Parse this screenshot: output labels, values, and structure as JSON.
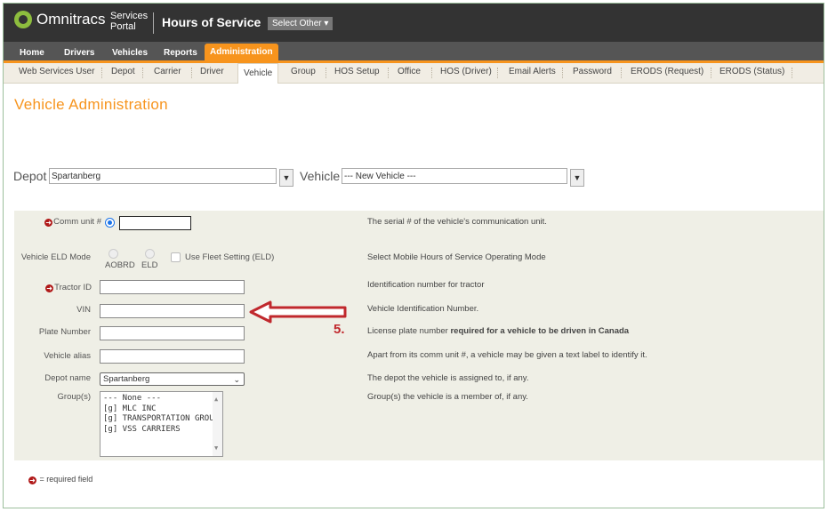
{
  "header": {
    "logo_text": "Omnitracs",
    "services_line1": "Services",
    "services_line2": "Portal",
    "app_title": "Hours of Service",
    "select_other": "Select Other ▾"
  },
  "nav": {
    "items": [
      "Home",
      "Drivers",
      "Vehicles",
      "Reports",
      "Administration"
    ],
    "active": "Administration"
  },
  "subnav": {
    "items": [
      "Web Services User",
      "Depot",
      "Carrier",
      "Driver",
      "Vehicle",
      "Group",
      "HOS Setup",
      "Office",
      "HOS (Driver)",
      "Email Alerts",
      "Password",
      "ERODS (Request)",
      "ERODS (Status)"
    ],
    "active": "Vehicle"
  },
  "page": {
    "title": "Vehicle Administration"
  },
  "selectors": {
    "depot_label": "Depot",
    "depot_value": "Spartanberg",
    "vehicle_label": "Vehicle",
    "vehicle_value": "--- New Vehicle ---"
  },
  "form": {
    "comm_unit": {
      "label": "Comm unit #",
      "value": "",
      "desc": "The serial # of the vehicle's communication unit."
    },
    "eld_mode": {
      "label": "Vehicle ELD Mode",
      "opt1": "AOBRD",
      "opt2": "ELD",
      "fleet_setting": "Use Fleet Setting (ELD)",
      "desc": "Select Mobile Hours of Service Operating Mode"
    },
    "tractor_id": {
      "label": "Tractor ID",
      "value": "",
      "desc": "Identification number for tractor"
    },
    "vin": {
      "label": "VIN",
      "value": "",
      "desc": "Vehicle Identification Number."
    },
    "plate": {
      "label": "Plate Number",
      "value": "",
      "desc_normal": "License plate number ",
      "desc_bold": "required for a vehicle to be driven in Canada"
    },
    "alias": {
      "label": "Vehicle alias",
      "value": "",
      "desc": "Apart from its comm unit #, a vehicle may be given a text label to identify it."
    },
    "depot_name": {
      "label": "Depot name",
      "value": "Spartanberg",
      "desc": "The depot the vehicle is assigned to, if any."
    },
    "groups": {
      "label": "Group(s)",
      "options": [
        "--- None ---",
        "[g] MLC INC",
        "[g] TRANSPORTATION GROUP",
        "[g] VSS CARRIERS"
      ],
      "desc": "Group(s) the vehicle is a member of, if any."
    }
  },
  "annotation": {
    "step": "5."
  },
  "legend": {
    "text": "= required field"
  },
  "colors": {
    "accent": "#f7941d",
    "required": "#b01818",
    "arrow": "#c0282d"
  }
}
